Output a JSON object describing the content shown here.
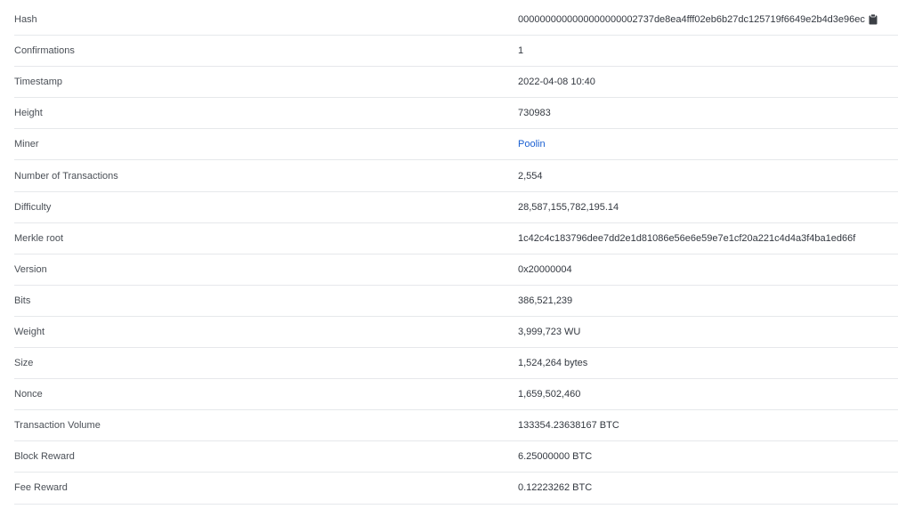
{
  "block": {
    "hash": {
      "label": "Hash",
      "value": "0000000000000000000002737de8ea4fff02eb6b27dc125719f6649e2b4d3e96ec"
    },
    "confirmations": {
      "label": "Confirmations",
      "value": "1"
    },
    "timestamp": {
      "label": "Timestamp",
      "value": "2022-04-08 10:40"
    },
    "height": {
      "label": "Height",
      "value": "730983"
    },
    "miner": {
      "label": "Miner",
      "value": "Poolin"
    },
    "tx_count": {
      "label": "Number of Transactions",
      "value": "2,554"
    },
    "difficulty": {
      "label": "Difficulty",
      "value": "28,587,155,782,195.14"
    },
    "merkle_root": {
      "label": "Merkle root",
      "value": "1c42c4c183796dee7dd2e1d81086e56e6e59e7e1cf20a221c4d4a3f4ba1ed66f"
    },
    "version": {
      "label": "Version",
      "value": "0x20000004"
    },
    "bits": {
      "label": "Bits",
      "value": "386,521,239"
    },
    "weight": {
      "label": "Weight",
      "value": "3,999,723 WU"
    },
    "size": {
      "label": "Size",
      "value": "1,524,264 bytes"
    },
    "nonce": {
      "label": "Nonce",
      "value": "1,659,502,460"
    },
    "tx_volume": {
      "label": "Transaction Volume",
      "value": "133354.23638167 BTC"
    },
    "block_reward": {
      "label": "Block Reward",
      "value": "6.25000000 BTC"
    },
    "fee_reward": {
      "label": "Fee Reward",
      "value": "0.12223262 BTC"
    }
  },
  "icons": {
    "copy": "clipboard-icon"
  },
  "colors": {
    "link": "#1a5fd1",
    "divider": "#e6e8eb"
  }
}
